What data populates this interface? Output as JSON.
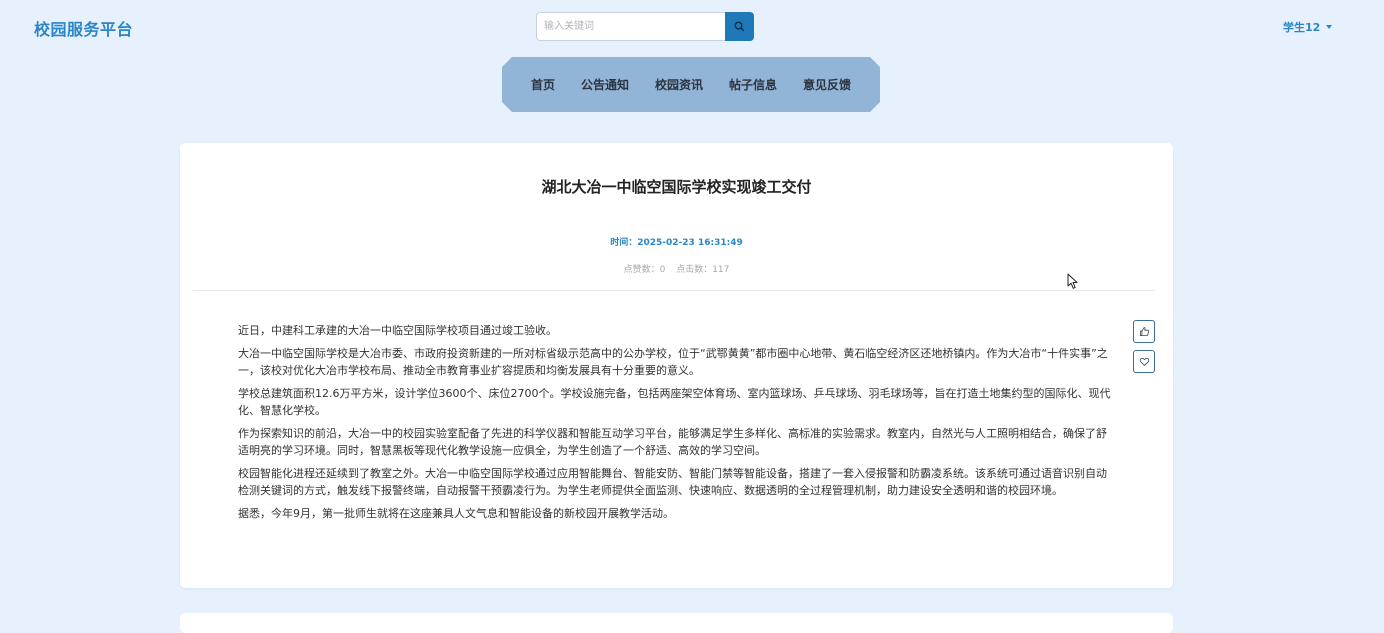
{
  "header": {
    "logo": "校园服务平台",
    "search_placeholder": "输入关键词",
    "user": "学生12"
  },
  "nav": {
    "items": [
      "首页",
      "公告通知",
      "校园资讯",
      "帖子信息",
      "意见反馈"
    ]
  },
  "article": {
    "title": "湖北大冶一中临空国际学校实现竣工交付",
    "time": "时间：2025-02-23 16:31:49",
    "likes": "点赞数：0",
    "clicks": "点击数：117",
    "paragraphs": [
      "近日，中建科工承建的大冶一中临空国际学校项目通过竣工验收。",
      "大冶一中临空国际学校是大冶市委、市政府投资新建的一所对标省级示范高中的公办学校，位于“武鄂黄黄”都市圈中心地带、黄石临空经济区还地桥镇内。作为大冶市“十件实事”之一，该校对优化大冶市学校布局、推动全市教育事业扩容提质和均衡发展具有十分重要的意义。",
      "学校总建筑面积12.6万平方米，设计学位3600个、床位2700个。学校设施完备，包括两座架空体育场、室内篮球场、乒乓球场、羽毛球场等，旨在打造土地集约型的国际化、现代化、智慧化学校。",
      "作为探索知识的前沿，大冶一中的校园实验室配备了先进的科学仪器和智能互动学习平台，能够满足学生多样化、高标准的实验需求。教室内，自然光与人工照明相结合，确保了舒适明亮的学习环境。同时，智慧黑板等现代化教学设施一应俱全，为学生创造了一个舒适、高效的学习空间。",
      "校园智能化进程还延续到了教室之外。大冶一中临空国际学校通过应用智能舞台、智能安防、智能门禁等智能设备，搭建了一套入侵报警和防霸凌系统。该系统可通过语音识别自动检测关键词的方式，触发线下报警终端，自动报警干预霸凌行为。为学生老师提供全面监测、快速响应、数据透明的全过程管理机制，助力建设安全透明和谐的校园环境。",
      "据悉，今年9月，第一批师生就将在这座兼具人文气息和智能设备的新校园开展教学活动。"
    ]
  },
  "icons": {
    "search": "search-icon",
    "like": "thumbs-up-icon",
    "favorite": "heart-icon",
    "dropdown": "chevron-down-icon"
  },
  "colors": {
    "brand": "#2a86c8",
    "search_button": "#1f78b8",
    "nav_background": "#92b4d6",
    "page_background": "#e6f1fd"
  }
}
